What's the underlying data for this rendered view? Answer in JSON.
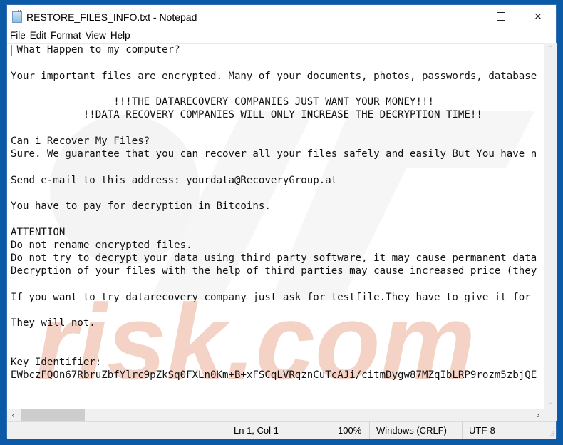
{
  "window": {
    "title": "RESTORE_FILES_INFO.txt - Notepad",
    "controls": {
      "minimize": "minimize",
      "maximize": "maximize",
      "close": "×"
    }
  },
  "menu": [
    {
      "label": "File"
    },
    {
      "label": "Edit"
    },
    {
      "label": "Format"
    },
    {
      "label": "View"
    },
    {
      "label": "Help"
    }
  ],
  "document": {
    "lines": [
      " What Happen to my computer?",
      "",
      "Your important files are encrypted. Many of your documents, photos, passwords, database",
      "",
      "                 !!!THE DATARECOVERY COMPANIES JUST WANT YOUR MONEY!!!",
      "            !!DATA RECOVERY COMPANIES WILL ONLY INCREASE THE DECRYPTION TIME!!",
      "",
      "Can i Recover My Files?",
      "Sure. We guarantee that you can recover all your files safely and easily But You have n",
      "",
      "Send e-mail to this address: yourdata@RecoveryGroup.at",
      "",
      "You have to pay for decryption in Bitcoins.",
      "",
      "ATTENTION",
      "Do not rename encrypted files.",
      "Do not try to decrypt your data using third party software, it may cause permanent data",
      "Decryption of your files with the help of third parties may cause increased price (they",
      "",
      "If you want to try datarecovery company just ask for testfile.They have to give it for",
      "",
      "They will not.",
      "",
      "",
      "Key Identifier:",
      "EWbczFQOn67RbruZbfYlrc9pZkSq0FXLn0Km+B+xFSCqLVRqznCuTcAJi/citmDygw87MZqIbLRP9rozm5zbjQE"
    ]
  },
  "scrollbars": {
    "up": "⌃",
    "down": "⌄",
    "left": "‹",
    "right": "›"
  },
  "status": {
    "position": "Ln 1, Col 1",
    "zoom": "100%",
    "line_ending": "Windows (CRLF)",
    "encoding": "UTF-8"
  },
  "watermark": {
    "text": "risk.com",
    "color": "#f2c9b8"
  }
}
